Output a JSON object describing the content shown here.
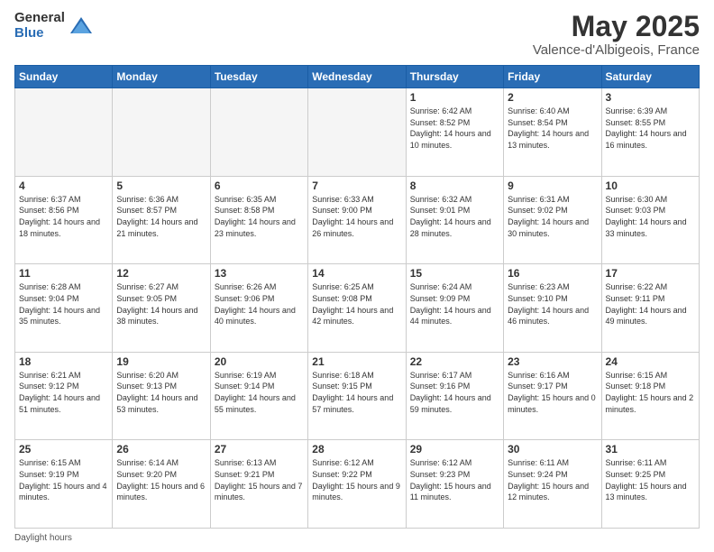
{
  "logo": {
    "general": "General",
    "blue": "Blue"
  },
  "header": {
    "month": "May 2025",
    "location": "Valence-d'Albigeois, France"
  },
  "days_of_week": [
    "Sunday",
    "Monday",
    "Tuesday",
    "Wednesday",
    "Thursday",
    "Friday",
    "Saturday"
  ],
  "footer": {
    "daylight_label": "Daylight hours"
  },
  "weeks": [
    [
      {
        "day": "",
        "info": ""
      },
      {
        "day": "",
        "info": ""
      },
      {
        "day": "",
        "info": ""
      },
      {
        "day": "",
        "info": ""
      },
      {
        "day": "1",
        "info": "Sunrise: 6:42 AM\nSunset: 8:52 PM\nDaylight: 14 hours\nand 10 minutes."
      },
      {
        "day": "2",
        "info": "Sunrise: 6:40 AM\nSunset: 8:54 PM\nDaylight: 14 hours\nand 13 minutes."
      },
      {
        "day": "3",
        "info": "Sunrise: 6:39 AM\nSunset: 8:55 PM\nDaylight: 14 hours\nand 16 minutes."
      }
    ],
    [
      {
        "day": "4",
        "info": "Sunrise: 6:37 AM\nSunset: 8:56 PM\nDaylight: 14 hours\nand 18 minutes."
      },
      {
        "day": "5",
        "info": "Sunrise: 6:36 AM\nSunset: 8:57 PM\nDaylight: 14 hours\nand 21 minutes."
      },
      {
        "day": "6",
        "info": "Sunrise: 6:35 AM\nSunset: 8:58 PM\nDaylight: 14 hours\nand 23 minutes."
      },
      {
        "day": "7",
        "info": "Sunrise: 6:33 AM\nSunset: 9:00 PM\nDaylight: 14 hours\nand 26 minutes."
      },
      {
        "day": "8",
        "info": "Sunrise: 6:32 AM\nSunset: 9:01 PM\nDaylight: 14 hours\nand 28 minutes."
      },
      {
        "day": "9",
        "info": "Sunrise: 6:31 AM\nSunset: 9:02 PM\nDaylight: 14 hours\nand 30 minutes."
      },
      {
        "day": "10",
        "info": "Sunrise: 6:30 AM\nSunset: 9:03 PM\nDaylight: 14 hours\nand 33 minutes."
      }
    ],
    [
      {
        "day": "11",
        "info": "Sunrise: 6:28 AM\nSunset: 9:04 PM\nDaylight: 14 hours\nand 35 minutes."
      },
      {
        "day": "12",
        "info": "Sunrise: 6:27 AM\nSunset: 9:05 PM\nDaylight: 14 hours\nand 38 minutes."
      },
      {
        "day": "13",
        "info": "Sunrise: 6:26 AM\nSunset: 9:06 PM\nDaylight: 14 hours\nand 40 minutes."
      },
      {
        "day": "14",
        "info": "Sunrise: 6:25 AM\nSunset: 9:08 PM\nDaylight: 14 hours\nand 42 minutes."
      },
      {
        "day": "15",
        "info": "Sunrise: 6:24 AM\nSunset: 9:09 PM\nDaylight: 14 hours\nand 44 minutes."
      },
      {
        "day": "16",
        "info": "Sunrise: 6:23 AM\nSunset: 9:10 PM\nDaylight: 14 hours\nand 46 minutes."
      },
      {
        "day": "17",
        "info": "Sunrise: 6:22 AM\nSunset: 9:11 PM\nDaylight: 14 hours\nand 49 minutes."
      }
    ],
    [
      {
        "day": "18",
        "info": "Sunrise: 6:21 AM\nSunset: 9:12 PM\nDaylight: 14 hours\nand 51 minutes."
      },
      {
        "day": "19",
        "info": "Sunrise: 6:20 AM\nSunset: 9:13 PM\nDaylight: 14 hours\nand 53 minutes."
      },
      {
        "day": "20",
        "info": "Sunrise: 6:19 AM\nSunset: 9:14 PM\nDaylight: 14 hours\nand 55 minutes."
      },
      {
        "day": "21",
        "info": "Sunrise: 6:18 AM\nSunset: 9:15 PM\nDaylight: 14 hours\nand 57 minutes."
      },
      {
        "day": "22",
        "info": "Sunrise: 6:17 AM\nSunset: 9:16 PM\nDaylight: 14 hours\nand 59 minutes."
      },
      {
        "day": "23",
        "info": "Sunrise: 6:16 AM\nSunset: 9:17 PM\nDaylight: 15 hours\nand 0 minutes."
      },
      {
        "day": "24",
        "info": "Sunrise: 6:15 AM\nSunset: 9:18 PM\nDaylight: 15 hours\nand 2 minutes."
      }
    ],
    [
      {
        "day": "25",
        "info": "Sunrise: 6:15 AM\nSunset: 9:19 PM\nDaylight: 15 hours\nand 4 minutes."
      },
      {
        "day": "26",
        "info": "Sunrise: 6:14 AM\nSunset: 9:20 PM\nDaylight: 15 hours\nand 6 minutes."
      },
      {
        "day": "27",
        "info": "Sunrise: 6:13 AM\nSunset: 9:21 PM\nDaylight: 15 hours\nand 7 minutes."
      },
      {
        "day": "28",
        "info": "Sunrise: 6:12 AM\nSunset: 9:22 PM\nDaylight: 15 hours\nand 9 minutes."
      },
      {
        "day": "29",
        "info": "Sunrise: 6:12 AM\nSunset: 9:23 PM\nDaylight: 15 hours\nand 11 minutes."
      },
      {
        "day": "30",
        "info": "Sunrise: 6:11 AM\nSunset: 9:24 PM\nDaylight: 15 hours\nand 12 minutes."
      },
      {
        "day": "31",
        "info": "Sunrise: 6:11 AM\nSunset: 9:25 PM\nDaylight: 15 hours\nand 13 minutes."
      }
    ]
  ]
}
